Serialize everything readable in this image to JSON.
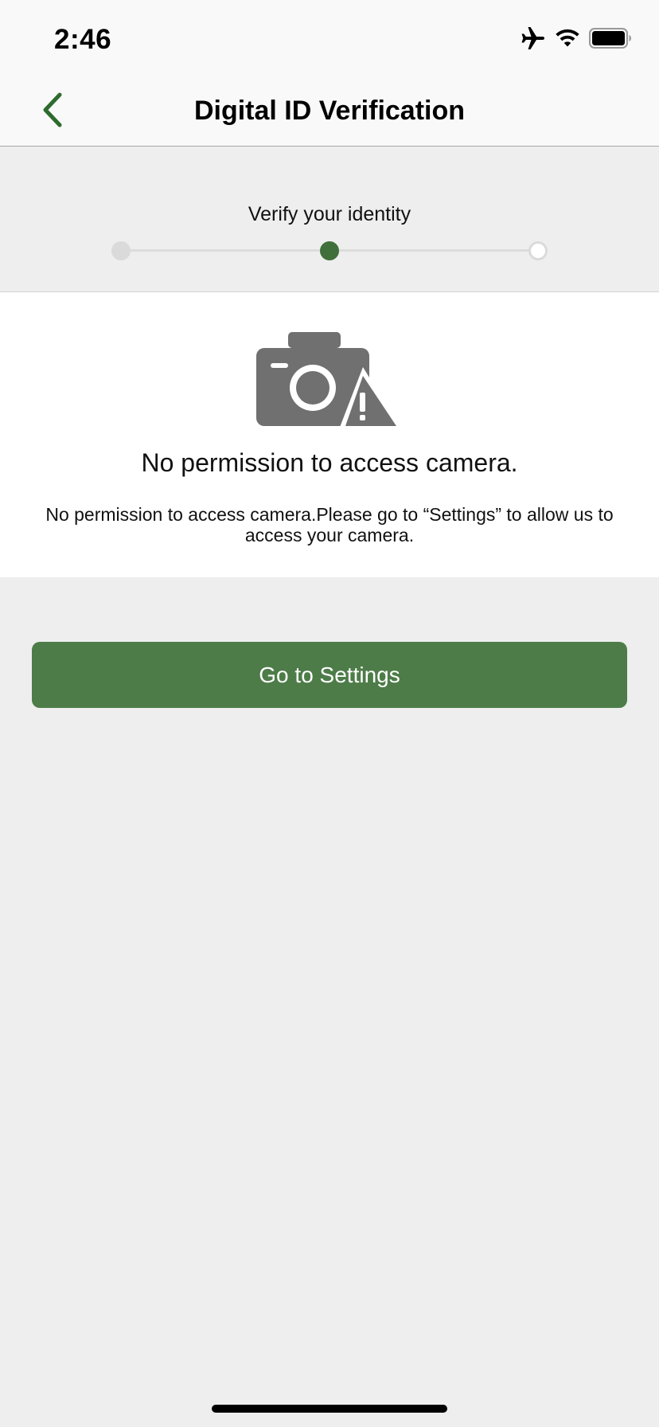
{
  "status_bar": {
    "time": "2:46",
    "icons": [
      "airplane-mode-icon",
      "wifi-icon",
      "battery-icon"
    ]
  },
  "nav": {
    "title": "Digital ID Verification",
    "back_icon": "chevron-left-icon"
  },
  "stepper": {
    "title": "Verify your identity",
    "steps": [
      "completed",
      "current",
      "upcoming"
    ]
  },
  "error": {
    "icon": "camera-warning-icon",
    "title": "No permission to access camera.",
    "description": "No permission to access camera.Please go to “Settings” to allow us to access your camera."
  },
  "actions": {
    "settings_label": "Go to Settings"
  },
  "colors": {
    "accent": "#4d7c48",
    "accent_dark": "#3f6f3a",
    "background": "#eeeeee",
    "icon_gray": "#707070"
  }
}
